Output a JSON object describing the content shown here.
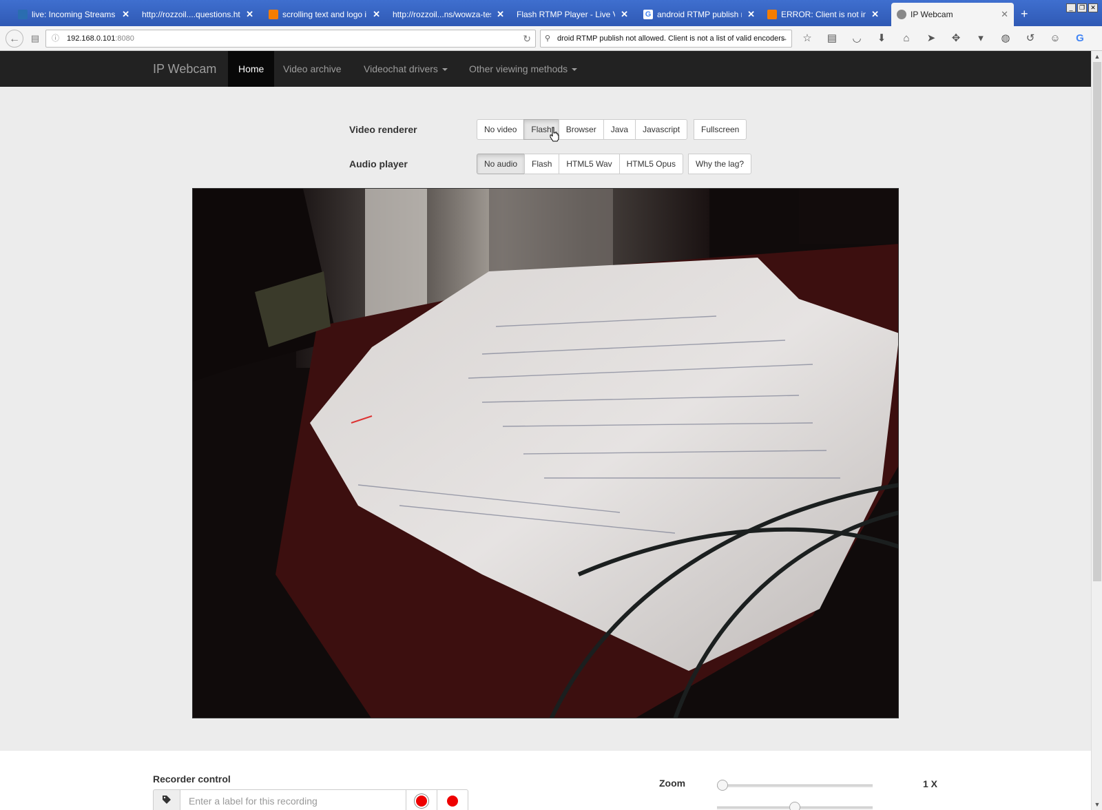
{
  "browser": {
    "tabs": [
      {
        "title": "live: Incoming Streams |...",
        "icon": "wowza-icon",
        "color": "#2a6db0"
      },
      {
        "title": "http://rozzoil....questions.html",
        "icon": "page-icon",
        "color": "#5b7fcb"
      },
      {
        "title": "scrolling text and logo i...",
        "icon": "blogger-icon",
        "color": "#f57d00"
      },
      {
        "title": "http://rozzoil...ns/wowza-test/",
        "icon": "page-icon",
        "color": "#5b7fcb"
      },
      {
        "title": "Flash RTMP Player - Live Vid...",
        "icon": "page-icon",
        "color": "#5b7fcb"
      },
      {
        "title": "android RTMP publish n...",
        "icon": "google-icon",
        "color": "#4285f4"
      },
      {
        "title": "ERROR: Client is not in l...",
        "icon": "blogger-icon",
        "color": "#f57d00"
      },
      {
        "title": "IP Webcam",
        "icon": "globe-icon",
        "color": "#888888"
      }
    ],
    "url_host": "192.168.0.101",
    "url_port": ":8080",
    "search_text": "droid RTMP publish not allowed. Client is not a list of valid encoders"
  },
  "site": {
    "brand": "IP Webcam",
    "nav": [
      "Home",
      "Video archive",
      "Videochat drivers",
      "Other viewing methods"
    ]
  },
  "video_renderer": {
    "label": "Video renderer",
    "options": [
      "No video",
      "Flash",
      "Browser",
      "Java",
      "Javascript"
    ],
    "selected": "Flash",
    "fullscreen": "Fullscreen"
  },
  "audio_player": {
    "label": "Audio player",
    "options": [
      "No audio",
      "Flash",
      "HTML5 Wav",
      "HTML5 Opus"
    ],
    "selected": "No audio",
    "lag_button": "Why the lag?"
  },
  "recorder": {
    "title": "Recorder control",
    "placeholder": "Enter a label for this recording"
  },
  "zoom": {
    "label": "Zoom",
    "value": "1 X",
    "level": 0.0,
    "second_slider_level": 0.5
  }
}
